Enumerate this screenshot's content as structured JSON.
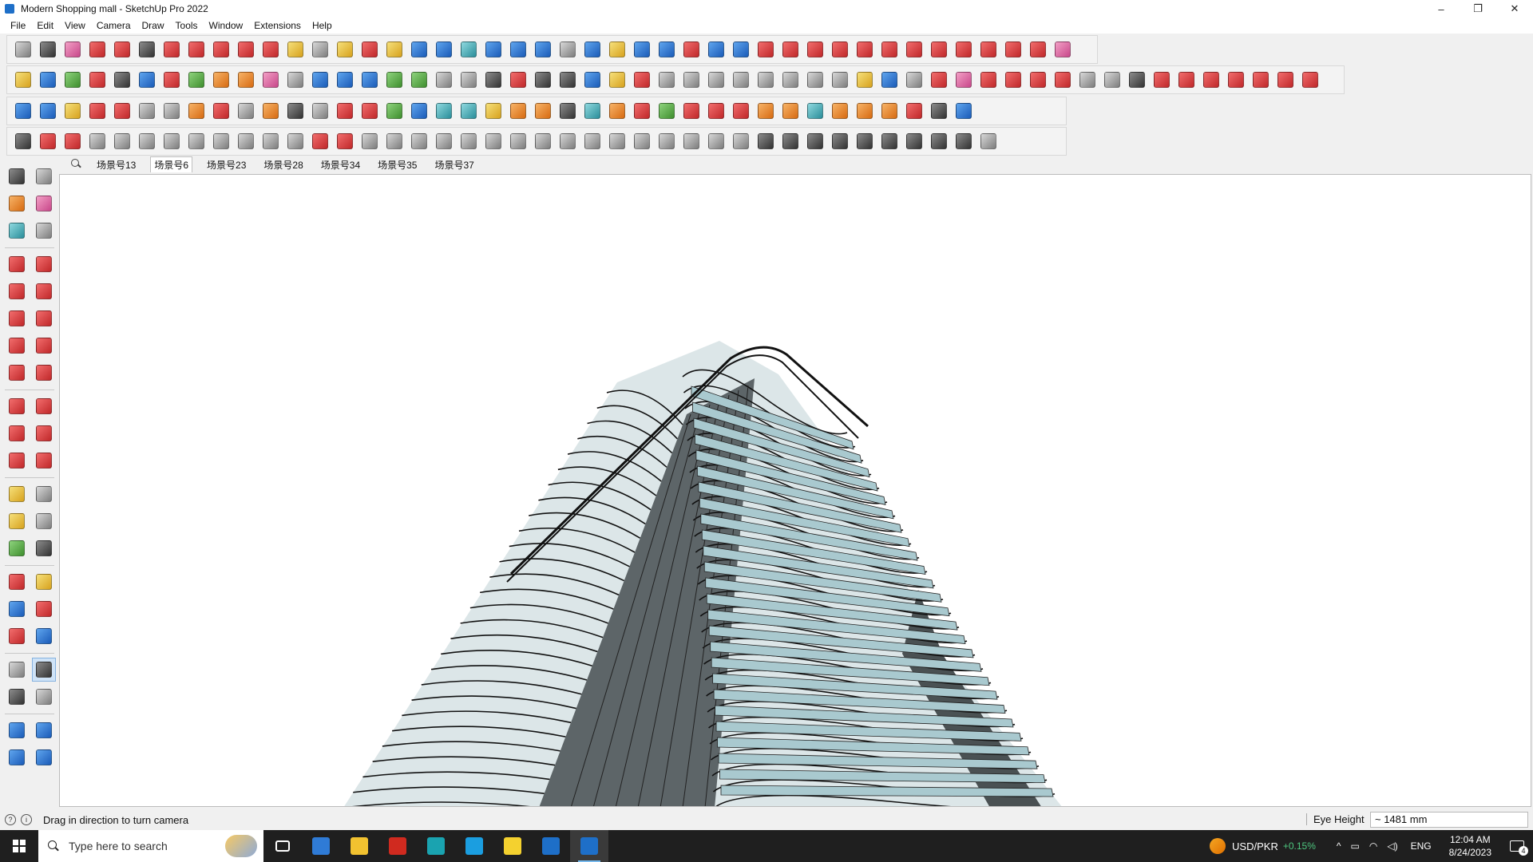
{
  "window": {
    "title": "Modern Shopping mall - SketchUp Pro 2022",
    "controls": [
      "–",
      "❐",
      "✕"
    ]
  },
  "menu": [
    "File",
    "Edit",
    "View",
    "Camera",
    "Draw",
    "Tools",
    "Window",
    "Extensions",
    "Help"
  ],
  "toolbar_rows": [
    [
      "c-gray",
      "c-dark",
      "c-pink",
      "c-red",
      "c-red",
      "c-dark",
      "c-red",
      "c-red",
      "c-red",
      "c-red",
      "c-red",
      "c-yellow",
      "c-gray",
      "c-yellow",
      "c-red",
      "c-yellow",
      "c-blue",
      "c-blue",
      "c-teal",
      "c-blue",
      "c-blue",
      "c-blue",
      "c-gray",
      "c-blue",
      "c-yellow",
      "c-blue",
      "c-blue",
      "c-red",
      "c-blue",
      "c-blue",
      "c-red",
      "c-red",
      "c-red",
      "c-red",
      "c-red",
      "c-red",
      "c-red",
      "c-red",
      "c-red",
      "c-red",
      "c-red",
      "c-red",
      "c-pink"
    ],
    [
      "c-yellow",
      "c-blue",
      "c-green",
      "c-red",
      "c-dark",
      "c-blue",
      "c-red",
      "c-green",
      "c-orange",
      "c-orange",
      "c-pink",
      "c-gray",
      "c-blue",
      "c-blue",
      "c-blue",
      "c-green",
      "c-green",
      "c-gray",
      "c-gray",
      "c-dark",
      "c-red",
      "c-dark",
      "c-dark",
      "c-blue",
      "c-yellow",
      "c-red",
      "c-gray",
      "c-gray",
      "c-gray",
      "c-gray",
      "c-gray",
      "c-gray",
      "c-gray",
      "c-gray",
      "c-yellow",
      "c-blue",
      "c-gray",
      "c-red",
      "c-pink",
      "c-red",
      "c-red",
      "c-red",
      "c-red",
      "c-gray",
      "c-gray",
      "c-dark",
      "c-red",
      "c-red",
      "c-red",
      "c-red",
      "c-red",
      "c-red",
      "c-red"
    ],
    [
      "c-blue",
      "c-blue",
      "c-yellow",
      "c-red",
      "c-red",
      "c-gray",
      "c-gray",
      "c-orange",
      "c-red",
      "c-gray",
      "c-orange",
      "c-dark",
      "c-gray",
      "c-red",
      "c-red",
      "c-green",
      "c-blue",
      "c-teal",
      "c-teal",
      "c-yellow",
      "c-orange",
      "c-orange",
      "c-dark",
      "c-teal",
      "c-orange",
      "c-red",
      "c-green",
      "c-red",
      "c-red",
      "c-red",
      "c-orange",
      "c-orange",
      "c-teal",
      "c-orange",
      "c-orange",
      "c-orange",
      "c-red",
      "c-dark",
      "c-blue"
    ],
    [
      "c-dark",
      "c-red",
      "c-red",
      "c-gray",
      "c-gray",
      "c-gray",
      "c-gray",
      "c-gray",
      "c-gray",
      "c-gray",
      "c-gray",
      "c-gray",
      "c-red",
      "c-red",
      "c-gray",
      "c-gray",
      "c-gray",
      "c-gray",
      "c-gray",
      "c-gray",
      "c-gray",
      "c-gray",
      "c-gray",
      "c-gray",
      "c-gray",
      "c-gray",
      "c-gray",
      "c-gray",
      "c-gray",
      "c-gray",
      "c-dark",
      "c-dark",
      "c-dark",
      "c-dark",
      "c-dark",
      "c-dark",
      "c-dark",
      "c-dark",
      "c-dark",
      "c-gray"
    ]
  ],
  "scenes": {
    "tabs": [
      "场景号13",
      "场景号6",
      "场景号23",
      "场景号28",
      "场景号34",
      "场景号35",
      "场景号37"
    ],
    "active_index": 1
  },
  "left_palette": [
    [
      "select-icon",
      "c-dark"
    ],
    [
      "orbit-icon",
      "c-gray"
    ],
    [
      "paint-bucket-icon",
      "c-orange"
    ],
    [
      "eraser-icon",
      "c-pink"
    ],
    [
      "component-icon",
      "c-teal"
    ],
    [
      "tag-icon",
      "c-gray"
    ],
    [
      "line-icon",
      "c-red"
    ],
    [
      "freehand-icon",
      "c-red"
    ],
    [
      "rectangle-icon",
      "c-red"
    ],
    [
      "rotated-rectangle-icon",
      "c-red"
    ],
    [
      "circle-icon",
      "c-red"
    ],
    [
      "polygon-icon",
      "c-red"
    ],
    [
      "arc-icon",
      "c-red"
    ],
    [
      "two-point-arc-icon",
      "c-red"
    ],
    [
      "three-point-arc-icon",
      "c-red"
    ],
    [
      "pie-icon",
      "c-red"
    ],
    [
      "move-icon",
      "c-red"
    ],
    [
      "push-pull-icon",
      "c-red"
    ],
    [
      "rotate-icon",
      "c-red"
    ],
    [
      "follow-me-icon",
      "c-red"
    ],
    [
      "scale-icon",
      "c-red"
    ],
    [
      "offset-icon",
      "c-red"
    ],
    [
      "tape-measure-icon",
      "c-yellow"
    ],
    [
      "dimension-icon",
      "c-gray"
    ],
    [
      "protractor-icon",
      "c-yellow"
    ],
    [
      "text-icon",
      "c-gray"
    ],
    [
      "axes-icon",
      "c-green"
    ],
    [
      "3d-text-icon",
      "c-dark"
    ],
    [
      "orbit-camera-icon",
      "c-red"
    ],
    [
      "pan-icon",
      "c-yellow"
    ],
    [
      "zoom-icon",
      "c-blue"
    ],
    [
      "zoom-window-icon",
      "c-red"
    ],
    [
      "zoom-extents-icon",
      "c-red"
    ],
    [
      "previous-view-icon",
      "c-blue"
    ],
    [
      "position-camera-icon",
      "c-gray"
    ],
    [
      "look-around-icon",
      "c-dark"
    ],
    [
      "walk-icon",
      "c-dark"
    ],
    [
      "section-plane-icon",
      "c-gray"
    ],
    [
      "warehouse-icon",
      "c-blue"
    ],
    [
      "extension-warehouse-icon",
      "c-blue"
    ],
    [
      "layout-icon",
      "c-blue"
    ],
    [
      "extension-manager-icon",
      "c-blue"
    ]
  ],
  "status": {
    "message": "Drag in direction to turn camera",
    "measure_label": "Eye Height",
    "measure_value": "~ 1481 mm"
  },
  "taskbar": {
    "search_placeholder": "Type here to search",
    "apps": [
      [
        "task-view-icon",
        "#1f1f1f",
        false
      ],
      [
        "calculator-icon",
        "#2f7bd6",
        false
      ],
      [
        "file-explorer-icon",
        "#f2c230",
        false
      ],
      [
        "acrobat-icon",
        "#d02a1f",
        false
      ],
      [
        "3ds-max-icon",
        "#1aa3b0",
        false
      ],
      [
        "edge-icon",
        "#1b9ee0",
        false
      ],
      [
        "sticky-notes-icon",
        "#f4d12f",
        false
      ],
      [
        "photos-icon",
        "#1e6fc8",
        false
      ],
      [
        "sketchup-icon",
        "#1e6fc8",
        true
      ]
    ],
    "stock_name": "USD/PKR",
    "stock_change": "+0.15%",
    "language": "ENG",
    "time": "12:04 AM",
    "date": "8/24/2023",
    "notification_count": "4"
  }
}
